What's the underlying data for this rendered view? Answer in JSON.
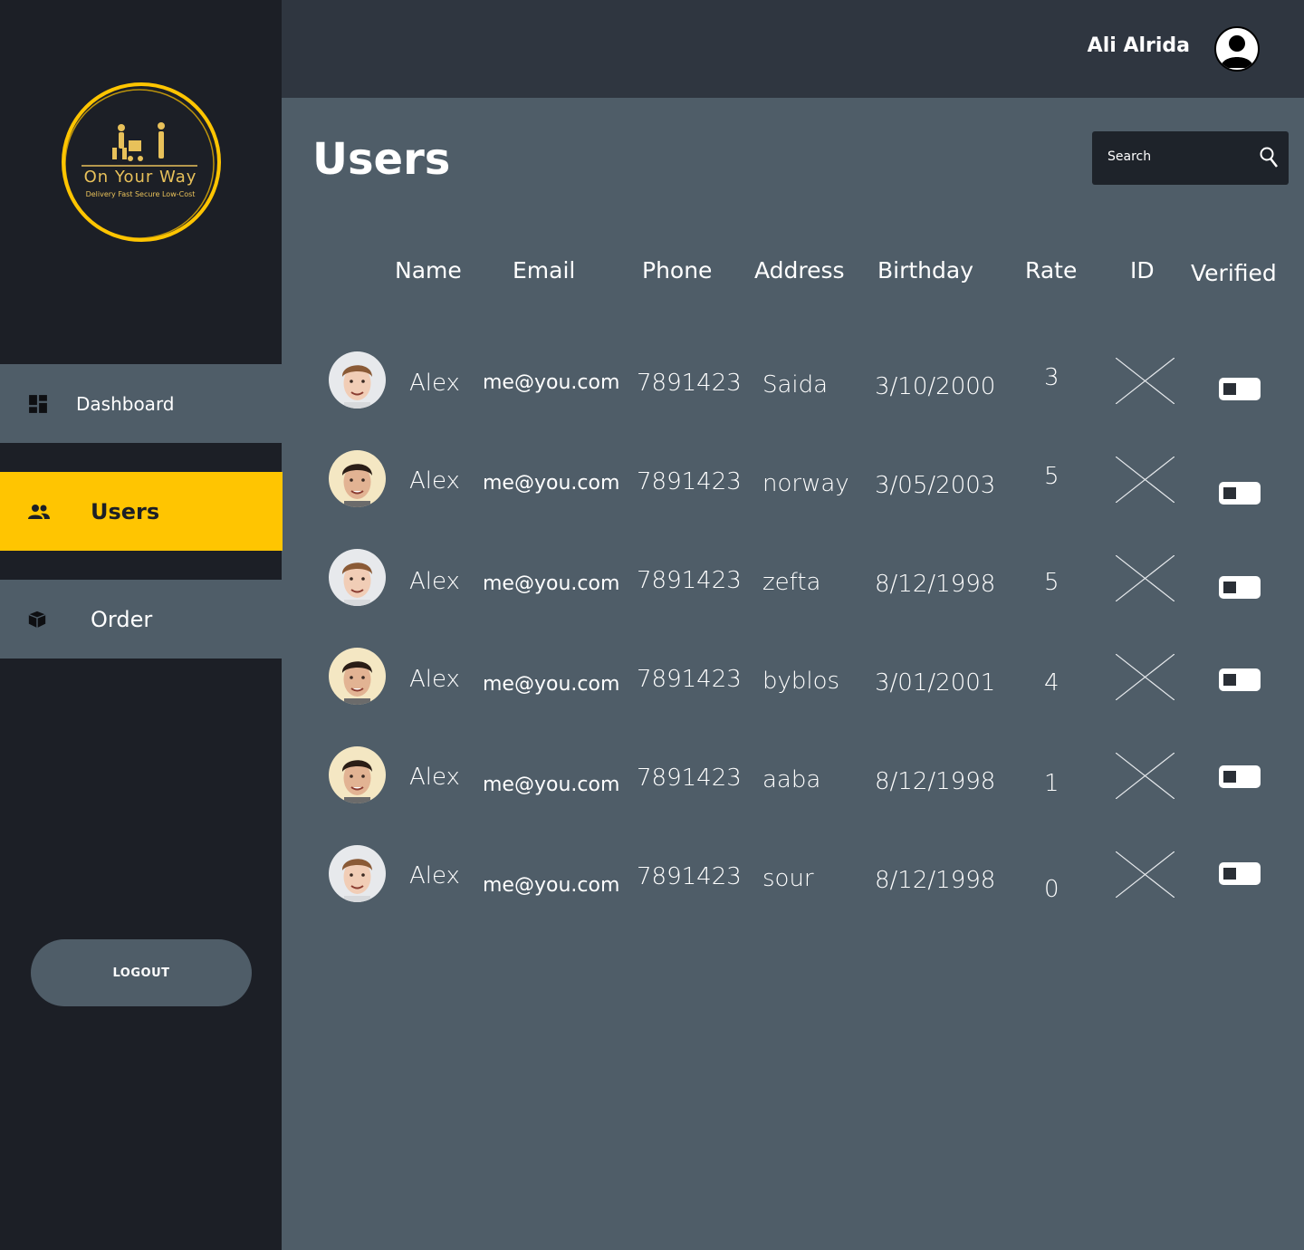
{
  "brand": {
    "name": "On Your Way",
    "tagline": "Delivery Fast Secure Low-Cost",
    "ring_color": "#ffc501",
    "logo_text_color": "#e8c15a"
  },
  "header": {
    "user_name": "Ali Alrida",
    "avatar_icon": "user-silhouette-icon"
  },
  "sidebar": {
    "items": [
      {
        "label": "Dashboard",
        "icon": "dashboard-icon",
        "active": false
      },
      {
        "label": "Users",
        "icon": "users-icon",
        "active": true
      },
      {
        "label": "Order",
        "icon": "box-icon",
        "active": false
      }
    ],
    "logout_label": "LOGOUT"
  },
  "page": {
    "title": "Users"
  },
  "search": {
    "placeholder": "Search",
    "icon": "search-icon"
  },
  "table": {
    "columns": [
      "Name",
      "Email",
      "Phone",
      "Address",
      "Birthday",
      "Rate",
      "ID",
      "Verified"
    ],
    "rows": [
      {
        "name": "Alex",
        "email": "me@you.com",
        "phone": "7891423",
        "address": "Saida",
        "birthday": "3/10/2000",
        "rate": "3"
      },
      {
        "name": "Alex",
        "email": "me@you.com",
        "phone": "7891423",
        "address": "norway",
        "birthday": "3/05/2003",
        "rate": "5"
      },
      {
        "name": "Alex",
        "email": "me@you.com",
        "phone": "7891423",
        "address": "zefta",
        "birthday": "8/12/1998",
        "rate": "5"
      },
      {
        "name": "Alex",
        "email": "me@you.com",
        "phone": "7891423",
        "address": "byblos",
        "birthday": "3/01/2001",
        "rate": "4"
      },
      {
        "name": "Alex",
        "email": "me@you.com",
        "phone": "7891423",
        "address": "aaba",
        "birthday": "8/12/1998",
        "rate": "1"
      },
      {
        "name": "Alex",
        "email": "me@you.com",
        "phone": "7891423",
        "address": "sour",
        "birthday": "8/12/1998",
        "rate": "0"
      }
    ]
  },
  "colors": {
    "sidebar_bg": "#1c1f26",
    "topbar_bg": "#2f3640",
    "content_bg": "#4f5d68",
    "accent": "#ffc501"
  }
}
